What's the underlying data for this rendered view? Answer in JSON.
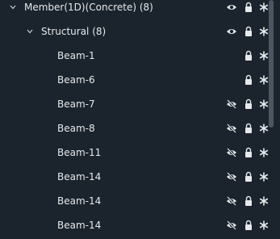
{
  "tree": {
    "root": {
      "label": "Member(1D)(Concrete) (8)",
      "visible": true
    },
    "group": {
      "label": "Structural (8)",
      "visible": true
    },
    "items": [
      {
        "label": "Beam-1",
        "state": "none"
      },
      {
        "label": "Beam-6",
        "state": "none"
      },
      {
        "label": "Beam-7",
        "state": "hidden"
      },
      {
        "label": "Beam-8",
        "state": "hidden"
      },
      {
        "label": "Beam-11",
        "state": "hidden"
      },
      {
        "label": "Beam-14",
        "state": "hidden"
      },
      {
        "label": "Beam-14",
        "state": "hidden"
      },
      {
        "label": "Beam-14",
        "state": "hidden"
      }
    ]
  },
  "icons": {
    "expand": "chevron-down-icon",
    "visible": "eye-icon",
    "hidden": "eye-slash-icon",
    "lock": "lock-icon",
    "snowflake": "asterisk-icon"
  },
  "colors": {
    "background": "#1b232c",
    "text": "#e6e9ec",
    "scrollbar": "#4d5660"
  }
}
